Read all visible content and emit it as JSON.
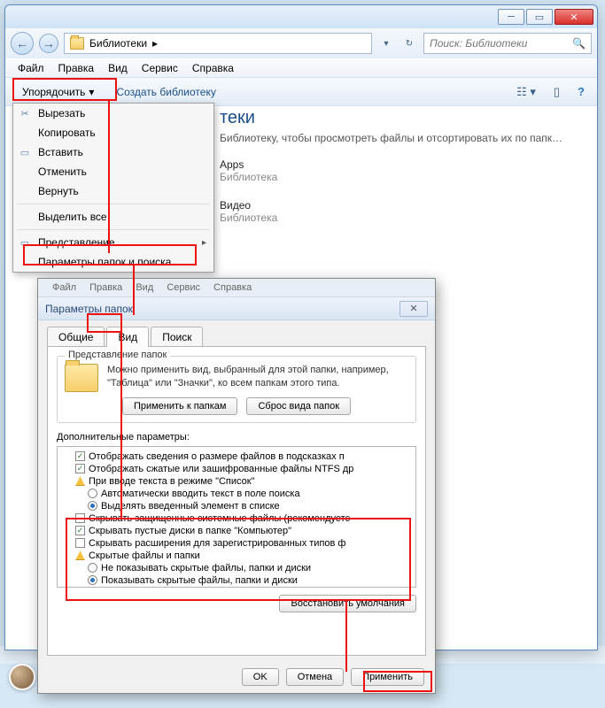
{
  "explorer": {
    "address": "Библиотеки",
    "arrow": "▸",
    "search_placeholder": "Поиск: Библиотеки",
    "menubar": [
      "Файл",
      "Правка",
      "Вид",
      "Сервис",
      "Справка"
    ],
    "toolbar": {
      "organize": "Упорядочить",
      "create_lib": "Создать библиотеку"
    },
    "content": {
      "title_partial": "теки",
      "subtitle": "Библиотеку, чтобы просмотреть файлы и отсортировать их по папк…",
      "items": [
        {
          "name": "Apps",
          "type": "Библиотека"
        },
        {
          "name": "Видео",
          "type": "Библиотека"
        }
      ]
    }
  },
  "dropdown": {
    "items": [
      {
        "label": "Вырезать",
        "icon": "✂"
      },
      {
        "label": "Копировать",
        "icon": ""
      },
      {
        "label": "Вставить",
        "icon": "▭"
      },
      {
        "label": "Отменить",
        "icon": ""
      },
      {
        "label": "Вернуть",
        "icon": ""
      }
    ],
    "select_all": "Выделить все",
    "layout": "Представление",
    "folder_options": "Параметры папок и поиска"
  },
  "dialog": {
    "title": "Параметры папок",
    "fake_menu": [
      "Файл",
      "Правка",
      "Вид",
      "Сервис",
      "Справка"
    ],
    "tabs": [
      "Общие",
      "Вид",
      "Поиск"
    ],
    "group1": {
      "title": "Представление папок",
      "text": "Можно применить вид, выбранный для этой папки, например, \"Таблица\" или \"Значки\", ко всем папкам этого типа.",
      "apply_btn": "Применить к папкам",
      "reset_btn": "Сброс вида папок"
    },
    "params_label": "Дополнительные параметры:",
    "tree": [
      {
        "type": "cb",
        "checked": true,
        "label": "Отображать сведения о размере файлов в подсказках п"
      },
      {
        "type": "cb",
        "checked": true,
        "label": "Отображать сжатые или зашифрованные файлы NTFS др"
      },
      {
        "type": "warn",
        "label": "При вводе текста в режиме \"Список\""
      },
      {
        "type": "radio",
        "checked": false,
        "sub": true,
        "label": "Автоматически вводить текст в поле поиска"
      },
      {
        "type": "radio",
        "checked": true,
        "sub": true,
        "label": "Выделять введенный элемент в списке"
      },
      {
        "type": "cb",
        "checked": false,
        "label": "Скрывать защищенные системные файлы (рекомендуетс"
      },
      {
        "type": "cb",
        "checked": true,
        "label": "Скрывать пустые диски в папке \"Компьютер\""
      },
      {
        "type": "cb",
        "checked": false,
        "label": "Скрывать расширения для зарегистрированных типов ф"
      },
      {
        "type": "warn",
        "label": "Скрытые файлы и папки"
      },
      {
        "type": "radio",
        "checked": false,
        "sub": true,
        "label": "Не показывать скрытые файлы, папки и диски"
      },
      {
        "type": "radio",
        "checked": true,
        "sub": true,
        "label": "Показывать скрытые файлы, папки и диски"
      }
    ],
    "restore_btn": "Восстановить умолчания",
    "buttons": {
      "ok": "OK",
      "cancel": "Отмена",
      "apply": "Применить"
    }
  }
}
